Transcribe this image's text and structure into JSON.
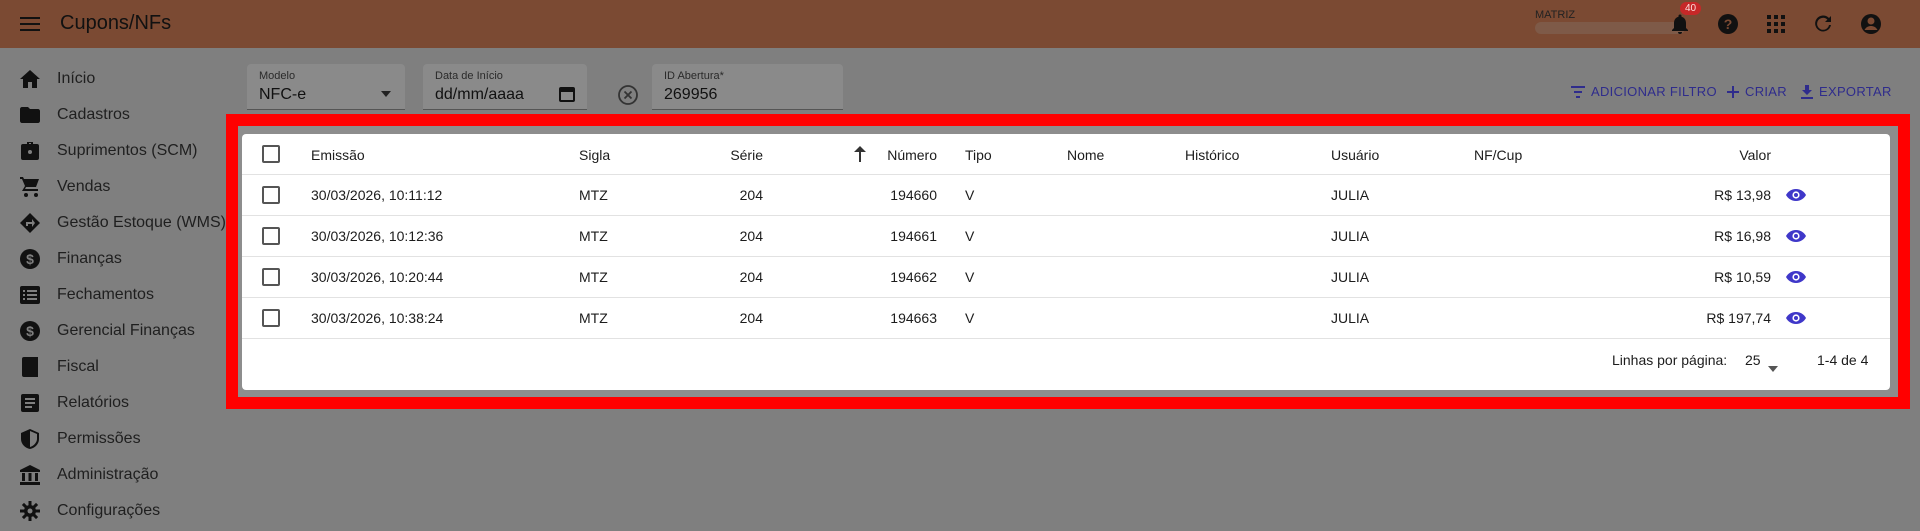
{
  "appbar": {
    "title": "Cupons/NFs",
    "company_label": "MATRIZ",
    "notification_count": "40",
    "brand_color": "#7b4a33"
  },
  "sidebar": {
    "items": [
      {
        "label": "Início",
        "icon": "home-icon"
      },
      {
        "label": "Cadastros",
        "icon": "folder-icon"
      },
      {
        "label": "Suprimentos (SCM)",
        "icon": "briefcase-icon"
      },
      {
        "label": "Vendas",
        "icon": "cart-icon"
      },
      {
        "label": "Gestão Estoque (WMS)",
        "icon": "directions-icon"
      },
      {
        "label": "Finanças",
        "icon": "dollar-icon"
      },
      {
        "label": "Fechamentos",
        "icon": "list-icon"
      },
      {
        "label": "Gerencial Finanças",
        "icon": "dollar-icon"
      },
      {
        "label": "Fiscal",
        "icon": "book-icon"
      },
      {
        "label": "Relatórios",
        "icon": "report-icon"
      },
      {
        "label": "Permissões",
        "icon": "shield-icon"
      },
      {
        "label": "Administração",
        "icon": "bank-icon"
      },
      {
        "label": "Configurações",
        "icon": "gear-icon"
      }
    ]
  },
  "filters": {
    "modelo": {
      "label": "Modelo",
      "value": "NFC-e"
    },
    "data_inicio": {
      "label": "Data de Início",
      "value": "dd/mm/aaaa"
    },
    "id_abertura": {
      "label": "ID Abertura*",
      "value": "269956"
    }
  },
  "actions": {
    "add_filter": "ADICIONAR FILTRO",
    "create": "CRIAR",
    "export": "EXPORTAR"
  },
  "table": {
    "headers": {
      "emissao": "Emissão",
      "sigla": "Sigla",
      "serie": "Série",
      "numero": "Número",
      "tipo": "Tipo",
      "nome": "Nome",
      "historico": "Histórico",
      "usuario": "Usuário",
      "nfcup": "NF/Cup",
      "valor": "Valor"
    },
    "rows": [
      {
        "emissao": "30/03/2026, 10:11:12",
        "sigla": "MTZ",
        "serie": "204",
        "numero": "194660",
        "tipo": "V",
        "nome": "",
        "historico": "",
        "usuario": "JULIA",
        "nfcup": "",
        "valor": "R$ 13,98"
      },
      {
        "emissao": "30/03/2026, 10:12:36",
        "sigla": "MTZ",
        "serie": "204",
        "numero": "194661",
        "tipo": "V",
        "nome": "",
        "historico": "",
        "usuario": "JULIA",
        "nfcup": "",
        "valor": "R$ 16,98"
      },
      {
        "emissao": "30/03/2026, 10:20:44",
        "sigla": "MTZ",
        "serie": "204",
        "numero": "194662",
        "tipo": "V",
        "nome": "",
        "historico": "",
        "usuario": "JULIA",
        "nfcup": "",
        "valor": "R$ 10,59"
      },
      {
        "emissao": "30/03/2026, 10:38:24",
        "sigla": "MTZ",
        "serie": "204",
        "numero": "194663",
        "tipo": "V",
        "nome": "",
        "historico": "",
        "usuario": "JULIA",
        "nfcup": "",
        "valor": "R$ 197,74"
      }
    ],
    "footer": {
      "rows_per_page_label": "Linhas por página:",
      "rows_per_page_value": "25",
      "range": "1-4 de 4"
    },
    "accent_color": "#3f37c9",
    "highlight_color": "#ff0000"
  }
}
